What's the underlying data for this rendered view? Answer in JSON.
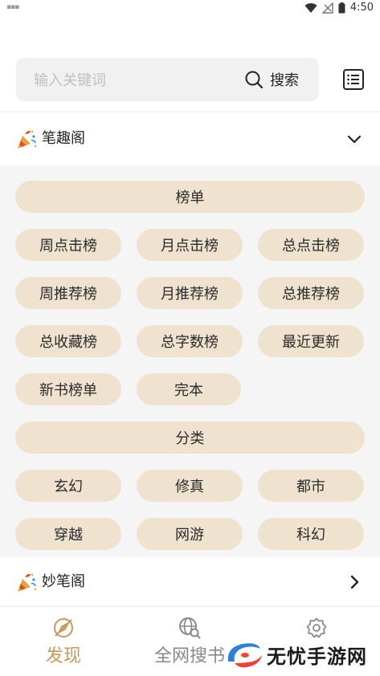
{
  "status_bar": {
    "time": "4:50"
  },
  "search": {
    "placeholder": "输入关键词",
    "value": "",
    "button_label": "搜索"
  },
  "sections": [
    {
      "title": "笔趣阁",
      "expanded": true
    },
    {
      "title": "妙笔阁",
      "expanded": false
    }
  ],
  "rank_group": {
    "header": "榜单",
    "items": [
      "周点击榜",
      "月点击榜",
      "总点击榜",
      "周推荐榜",
      "月推荐榜",
      "总推荐榜",
      "总收藏榜",
      "总字数榜",
      "最近更新",
      "新书榜单",
      "完本"
    ]
  },
  "category_group": {
    "header": "分类",
    "items": [
      "玄幻",
      "修真",
      "都市",
      "穿越",
      "网游",
      "科幻"
    ]
  },
  "bottom_nav": {
    "items": [
      {
        "label": "发现",
        "icon": "compass-icon",
        "active": true
      },
      {
        "label": "全网搜书",
        "icon": "globe-search-icon",
        "active": false
      },
      {
        "label": "",
        "icon": "gear-icon",
        "active": false
      }
    ]
  },
  "watermark": {
    "text": "无忧手游网"
  },
  "colors": {
    "accent": "#c39a5c",
    "pill_bg": "#efe2cf",
    "panel_bg": "#f5f5f5",
    "inactive": "#888888"
  }
}
